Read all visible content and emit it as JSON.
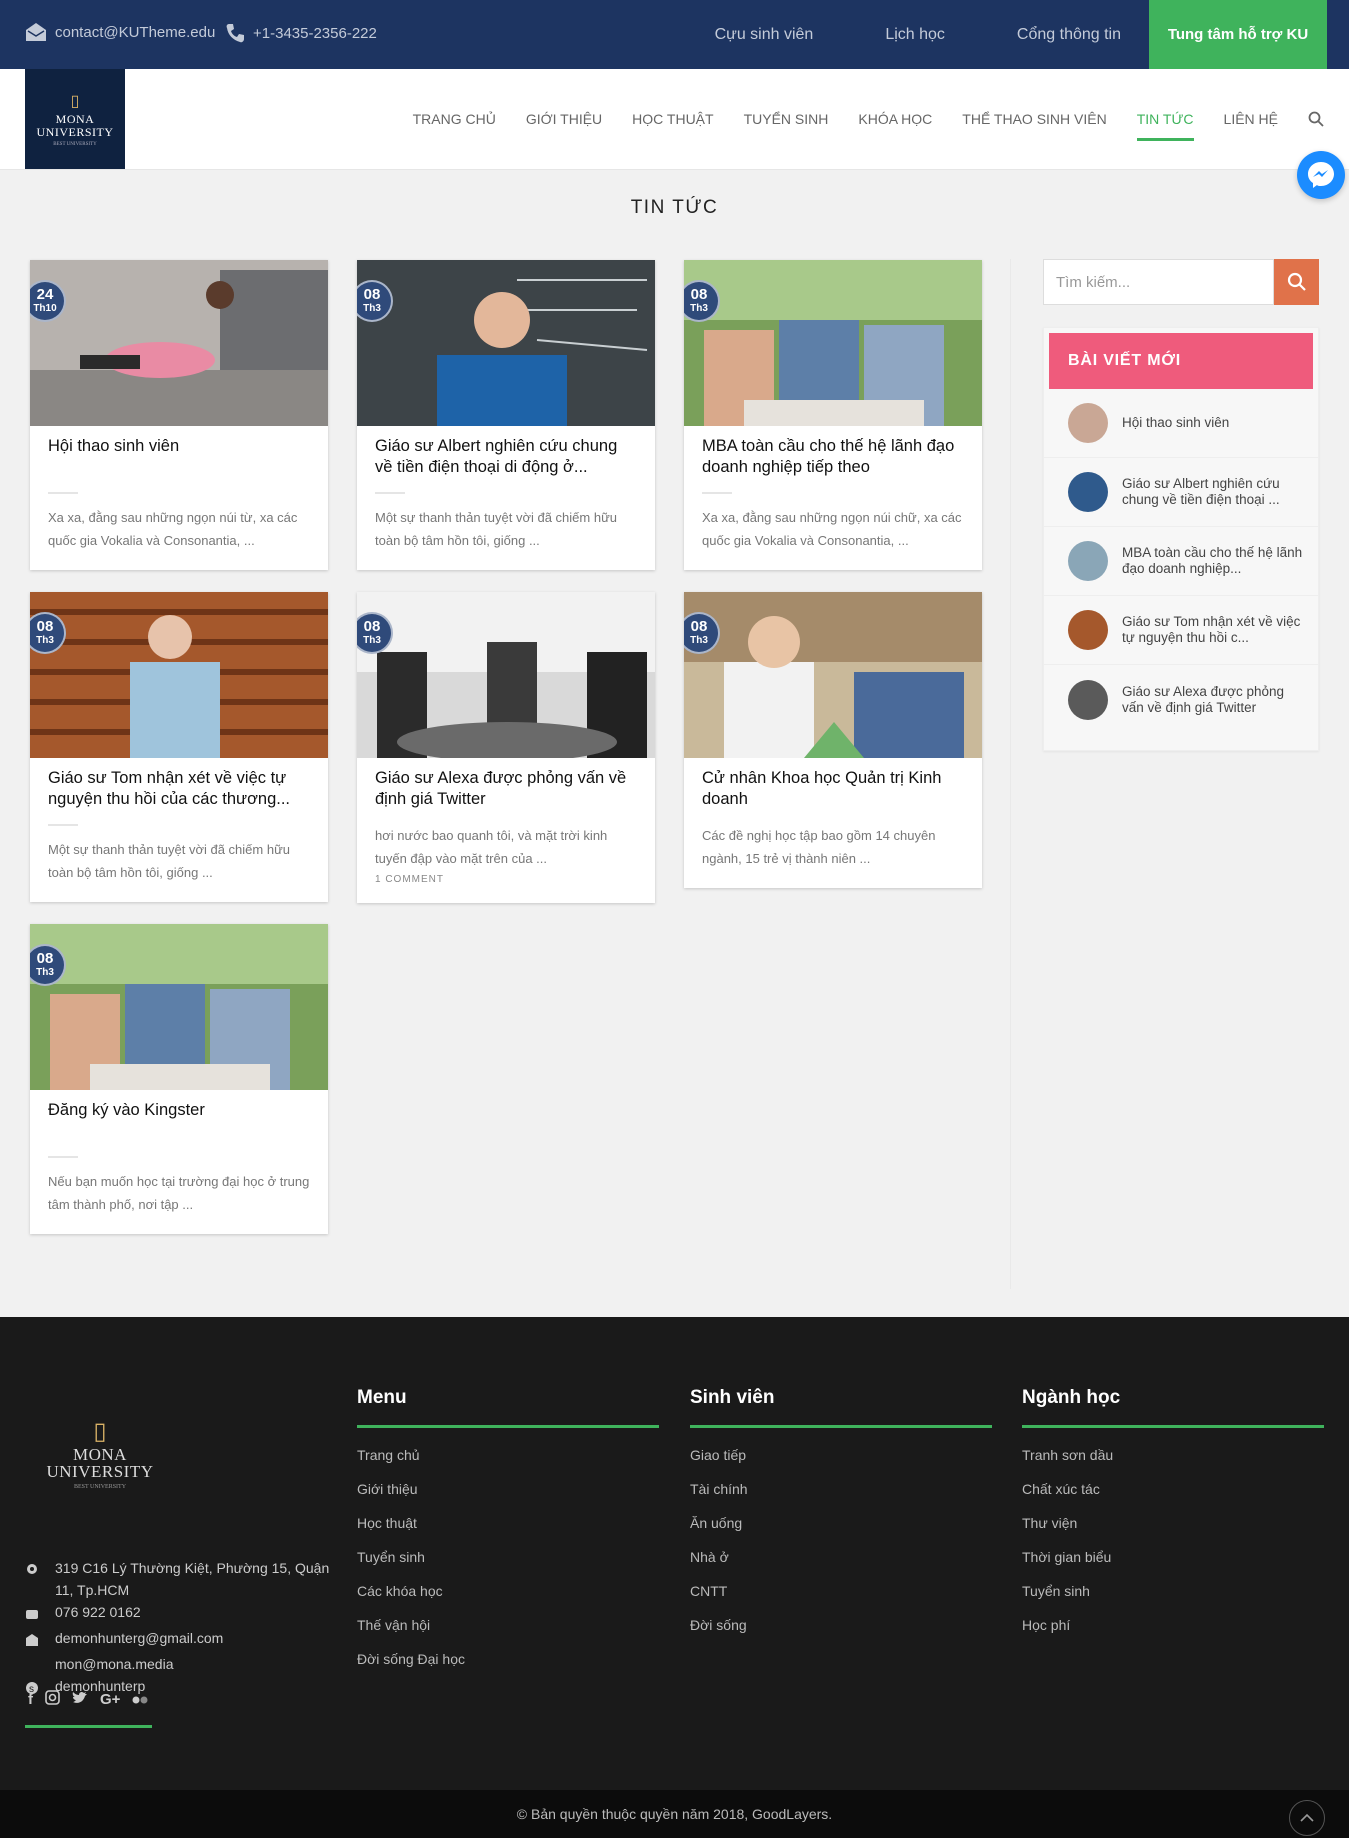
{
  "topbar": {
    "email": "contact@KUTheme.edu",
    "phone": "+1-3435-2356-222",
    "links": [
      "Cựu sinh viên",
      "Lịch học",
      "Cổng thông tin"
    ],
    "cta": "Tung tâm hỗ trợ KU"
  },
  "brand": {
    "name": "MONA UNIVERSITY",
    "name_line1": "MONA",
    "name_line2": "UNIVERSITY",
    "tagline": "BEST UNIVERSITY"
  },
  "nav": [
    "TRANG CHỦ",
    "GIỚI THIỆU",
    "HỌC THUẬT",
    "TUYỂN SINH",
    "KHÓA HỌC",
    "THỂ THAO SINH VIÊN",
    "TIN TỨC",
    "LIÊN HỆ"
  ],
  "nav_active": "TIN TỨC",
  "page_title": "TIN TỨC",
  "posts": [
    {
      "day": "24",
      "month": "Th10",
      "title": "Hội thao sinh viên",
      "excerpt": "Xa xa, đằng sau những ngọn núi từ, xa các quốc gia Vokalia và Consonantia, ...",
      "comment": ""
    },
    {
      "day": "08",
      "month": "Th3",
      "title": "Giáo sư Albert nghiên cứu chung về tiền điện thoại di động ở...",
      "excerpt": "Một sự thanh thản tuyệt vời đã chiếm hữu toàn bộ tâm hồn tôi, giống ...",
      "comment": ""
    },
    {
      "day": "08",
      "month": "Th3",
      "title": "MBA toàn cầu cho thế hệ lãnh đạo doanh nghiệp tiếp theo",
      "excerpt": "Xa xa, đằng sau những ngọn núi chữ, xa các quốc gia Vokalia và Consonantia, ...",
      "comment": ""
    },
    {
      "day": "08",
      "month": "Th3",
      "title": "Giáo sư Tom nhận xét về việc tự nguyện thu hồi của các thương...",
      "excerpt": "Một sự thanh thản tuyệt vời đã chiếm hữu toàn bộ tâm hồn tôi, giống ...",
      "comment": ""
    },
    {
      "day": "08",
      "month": "Th3",
      "title": "Giáo sư Alexa được phỏng vấn về định giá Twitter",
      "excerpt": "hơi nước bao quanh tôi, và mặt trời kinh tuyến đập vào mặt trên của ...",
      "comment": "1 COMMENT"
    },
    {
      "day": "08",
      "month": "Th3",
      "title": "Cử nhân Khoa học Quản trị Kinh doanh",
      "excerpt": "Các đề nghị học tập bao gồm 14 chuyên ngành, 15 trẻ vị thành niên ...",
      "comment": ""
    },
    {
      "day": "08",
      "month": "Th3",
      "title": "Đăng ký vào Kingster",
      "excerpt": "Nếu bạn muốn học tại trường đại học ở trung tâm thành phố, nơi tập ...",
      "comment": ""
    }
  ],
  "sidebar": {
    "search_placeholder": "Tìm kiếm...",
    "recent_title": "BÀI VIẾT MỚI",
    "recent": [
      "Hội thao sinh viên",
      "Giáo sư Albert nghiên cứu chung về tiền điện thoại ...",
      "MBA toàn cầu cho thế hệ lãnh đạo doanh nghiệp...",
      "Giáo sư Tom nhận xét về việc tự nguyện thu hồi c...",
      "Giáo sư Alexa được phỏng vấn về định giá Twitter"
    ]
  },
  "footer": {
    "address": "319 C16 Lý Thường Kiệt, Phường 15, Quận 11, Tp.HCM",
    "phone": "076 922 0162",
    "email1": "demonhunterg@gmail.com",
    "email2": "mon@mona.media",
    "skype": "demonhunterp",
    "columns": [
      {
        "title": "Menu",
        "items": [
          "Trang chủ",
          "Giới thiệu",
          "Học thuật",
          "Tuyển sinh",
          "Các khóa học",
          "Thế vận hội",
          "Đời sống Đại học"
        ]
      },
      {
        "title": "Sinh viên",
        "items": [
          "Giao tiếp",
          "Tài chính",
          "Ăn uống",
          "Nhà ở",
          "CNTT",
          "Đời sống"
        ]
      },
      {
        "title": "Ngành học",
        "items": [
          "Tranh sơn dầu",
          "Chất xúc tác",
          "Thư viện",
          "Thời gian biểu",
          "Tuyển sinh",
          "Học phí"
        ]
      }
    ],
    "copyright": "© Bản quyền thuộc quyền năm 2018, GoodLayers."
  },
  "colors": {
    "topbar": "#1d3461",
    "accent_green": "#3fb35c",
    "recent_header": "#ef5b7c",
    "search_button": "#e0724a",
    "footer": "#1a1a1a"
  }
}
